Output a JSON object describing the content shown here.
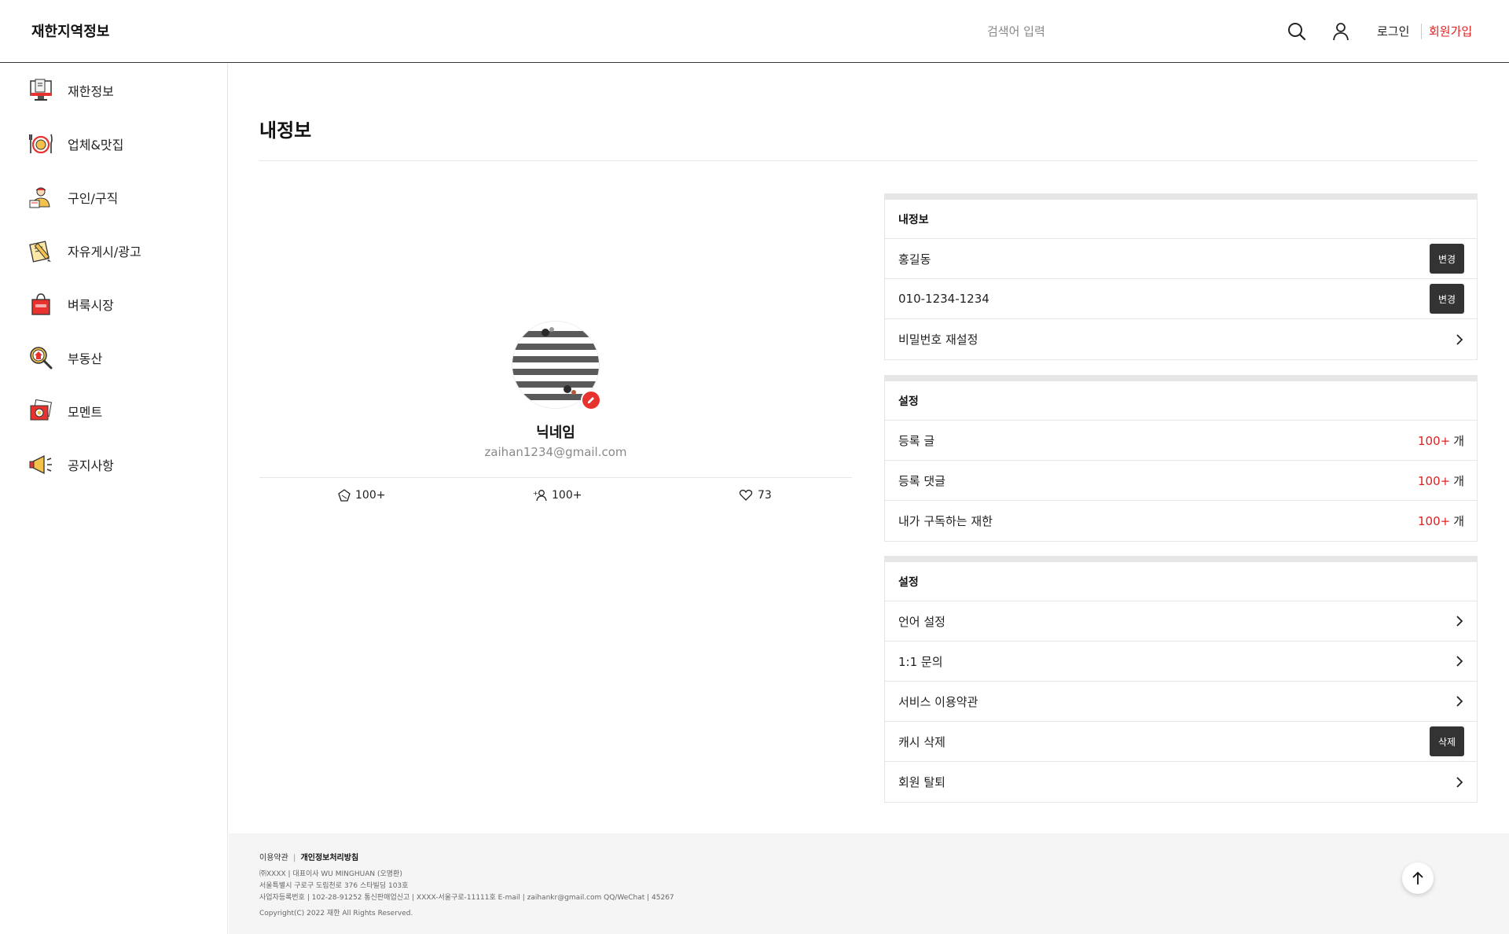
{
  "header": {
    "logo": "재한지역정보",
    "search_placeholder": "검색어 입력",
    "login": "로그인",
    "signup": "회원가입"
  },
  "sidebar": {
    "items": [
      {
        "label": "재한정보",
        "icon": "monitor-icon"
      },
      {
        "label": "업체&맛집",
        "icon": "dining-icon"
      },
      {
        "label": "구인/구직",
        "icon": "worker-icon"
      },
      {
        "label": "자유게시/광고",
        "icon": "notepad-pencil-icon"
      },
      {
        "label": "벼룩시장",
        "icon": "shopping-bag-icon"
      },
      {
        "label": "부동산",
        "icon": "house-search-icon"
      },
      {
        "label": "모멘트",
        "icon": "photos-icon"
      },
      {
        "label": "공지사항",
        "icon": "megaphone-icon"
      }
    ]
  },
  "main": {
    "title": "내정보"
  },
  "profile": {
    "nickname": "닉네임",
    "email": "zaihan1234@gmail.com",
    "stats": [
      {
        "icon": "badge-icon",
        "value": "100+"
      },
      {
        "icon": "add-user-icon",
        "value": "100+"
      },
      {
        "icon": "heart-icon",
        "value": "73"
      }
    ]
  },
  "panels": {
    "info": {
      "title": "내정보",
      "name": "홍길동",
      "phone": "010-1234-1234",
      "change_label": "변경",
      "password_reset": "비밀번호 재설정"
    },
    "activity": {
      "title": "설정",
      "unit": "개",
      "rows": [
        {
          "label": "등록 글",
          "count": "100+"
        },
        {
          "label": "등록 댓글",
          "count": "100+"
        },
        {
          "label": "내가 구독하는 재한",
          "count": "100+"
        }
      ]
    },
    "settings": {
      "title": "설정",
      "language": "언어 설정",
      "inquiry": "1:1 문의",
      "terms": "서비스 이용약관",
      "cache": "캐시 삭제",
      "delete_label": "삭제",
      "withdraw": "회원 탈퇴"
    }
  },
  "footer": {
    "terms": "이용약관",
    "sep": "|",
    "privacy": "개인정보처리방침",
    "company": "㈜XXXX  |  대표이사 WU MINGHUAN (오명환)",
    "address": "서울특별시 구로구 도림천로 376 스타빌딩 103호",
    "business": "사업자등록번호 | 102-28-91252     통신판매업신고 | XXXX-서울구로-11111호     E-mail | zaihankr@gmail.com     QQ/WeChat | 45267",
    "copyright": "Copyright(C) 2022 재한 All Rights Reserved."
  },
  "colors": {
    "accent": "#e02020",
    "dark_button": "#333333",
    "border": "#e6e6e6",
    "footer_bg": "#f5f5f5"
  }
}
